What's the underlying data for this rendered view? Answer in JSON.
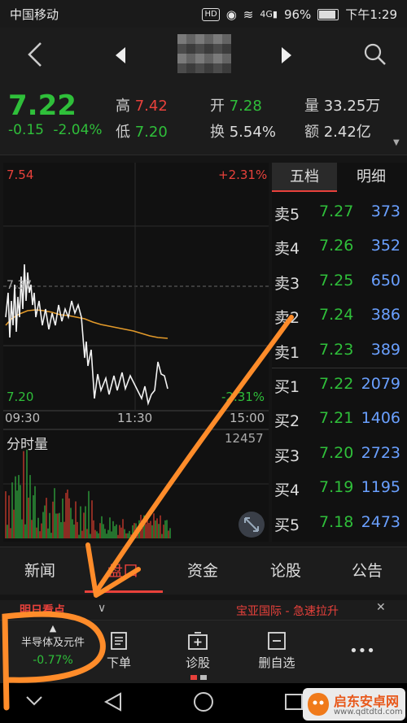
{
  "status_bar": {
    "carrier": "中国移动",
    "hd": "HD",
    "signal": "4G",
    "battery": "96%",
    "time": "下午1:29"
  },
  "quote": {
    "price": "7.22",
    "change": "-0.15",
    "change_pct": "-2.04%",
    "high_label": "高",
    "high": "7.42",
    "low_label": "低",
    "low": "7.20",
    "open_label": "开",
    "open": "7.28",
    "turnover_label": "换",
    "turnover": "5.54%",
    "volume_label": "量",
    "volume": "33.25万",
    "amount_label": "额",
    "amount": "2.42亿"
  },
  "chart": {
    "top_price": "7.54",
    "top_pct": "+2.31%",
    "bottom_price": "7.20",
    "bottom_pct": "-2.31%",
    "mid_label": "7.37",
    "time_start": "09:30",
    "time_mid": "11:30",
    "time_end": "15:00",
    "volume_title": "分时量",
    "volume_max": "12457"
  },
  "order_book": {
    "tab_five": "五档",
    "tab_detail": "明细",
    "rows": [
      {
        "label": "卖5",
        "price": "7.27",
        "volume": "373"
      },
      {
        "label": "卖4",
        "price": "7.26",
        "volume": "352"
      },
      {
        "label": "卖3",
        "price": "7.25",
        "volume": "650"
      },
      {
        "label": "卖2",
        "price": "7.24",
        "volume": "386"
      },
      {
        "label": "卖1",
        "price": "7.23",
        "volume": "389"
      },
      {
        "label": "买1",
        "price": "7.22",
        "volume": "2079"
      },
      {
        "label": "买2",
        "price": "7.21",
        "volume": "1406"
      },
      {
        "label": "买3",
        "price": "7.20",
        "volume": "2723"
      },
      {
        "label": "买4",
        "price": "7.19",
        "volume": "1195"
      },
      {
        "label": "买5",
        "price": "7.18",
        "volume": "2473"
      }
    ]
  },
  "tabs": [
    "新闻",
    "盘口",
    "资金",
    "论股",
    "公告"
  ],
  "news_strip": {
    "left": "明日看点",
    "right": "宝亚国际 - 急速拉升"
  },
  "bottom_bar": {
    "sector_name": "半导体及元件",
    "sector_change": "-0.77%",
    "order": "下单",
    "diagnose": "诊股",
    "remove_watch": "删自选",
    "more": "•••"
  },
  "watermark": {
    "name": "启东安卓网",
    "url": "www.qdtdtd.com"
  },
  "colors": {
    "up": "#e8413b",
    "down": "#2fbf3a",
    "volume_blue": "#6aa0ff",
    "avg_line": "#e39a2a",
    "annotation": "#ff8c2a"
  }
}
